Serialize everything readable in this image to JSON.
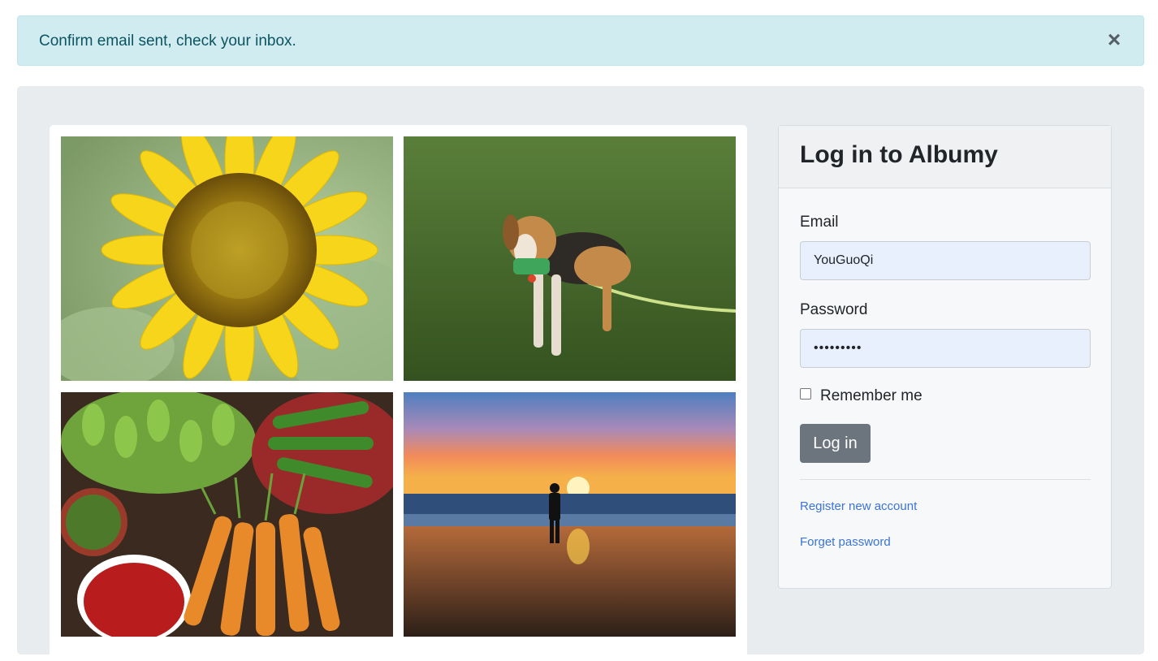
{
  "alert": {
    "message": "Confirm email sent, check your inbox.",
    "close_label": "×"
  },
  "gallery": {
    "photos": [
      {
        "subject": "sunflower"
      },
      {
        "subject": "beagle-on-grass"
      },
      {
        "subject": "vegetables-market"
      },
      {
        "subject": "sunset-beach"
      }
    ]
  },
  "login": {
    "title": "Log in to Albumy",
    "email_label": "Email",
    "email_value": "YouGuoQi",
    "password_label": "Password",
    "password_value": "•••••••••",
    "remember_label": "Remember me",
    "submit_label": "Log in",
    "register_link": "Register new account",
    "forget_link": "Forget password"
  },
  "colors": {
    "alert_bg": "#d1ecf1",
    "alert_text": "#0c5460",
    "button": "#6c757d",
    "link": "#3b74d5",
    "input_bg": "#e8f0fe"
  }
}
